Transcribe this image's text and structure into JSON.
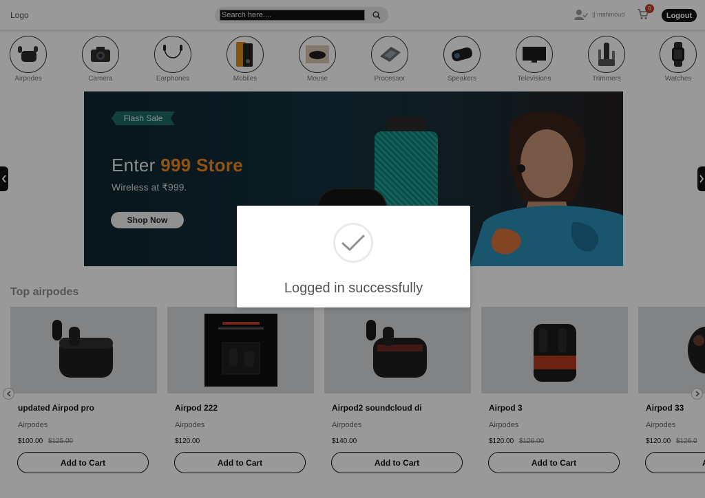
{
  "header": {
    "logo": "Logo",
    "search_placeholder": "Search here....",
    "user_name": "|| mahmoud",
    "cart_count": "0",
    "logout_label": "Logout"
  },
  "categories": [
    {
      "label": "Airpodes",
      "icon": "airpods-icon"
    },
    {
      "label": "Camera",
      "icon": "camera-icon"
    },
    {
      "label": "Earphones",
      "icon": "earphones-icon"
    },
    {
      "label": "Mobiles",
      "icon": "mobile-icon"
    },
    {
      "label": "Mouse",
      "icon": "mouse-icon"
    },
    {
      "label": "Processor",
      "icon": "processor-icon"
    },
    {
      "label": "Speakers",
      "icon": "speaker-icon"
    },
    {
      "label": "Televisions",
      "icon": "television-icon"
    },
    {
      "label": "Trimmers",
      "icon": "trimmer-icon"
    },
    {
      "label": "Watches",
      "icon": "watch-icon"
    }
  ],
  "banner": {
    "badge": "Flash Sale",
    "title_prefix": "Enter",
    "title_highlight": "999 Store",
    "subtitle": "Wireless at ₹999.",
    "cta": "Shop Now"
  },
  "section": {
    "title": "Top airpodes"
  },
  "products": [
    {
      "name": "updated Airpod pro",
      "category": "Airpodes",
      "price": "$100.00",
      "old_price": "$125.00",
      "button": "Add to Cart"
    },
    {
      "name": "Airpod 222",
      "category": "Airpodes",
      "price": "$120.00",
      "old_price": "",
      "button": "Add to Cart"
    },
    {
      "name": "Airpod2 soundcloud di",
      "category": "Airpodes",
      "price": "$140.00",
      "old_price": "",
      "button": "Add to Cart"
    },
    {
      "name": "Airpod 3",
      "category": "Airpodes",
      "price": "$120.00",
      "old_price": "$126.00",
      "button": "Add to Cart"
    },
    {
      "name": "Airpod 33",
      "category": "Airpodes",
      "price": "$120.00",
      "old_price": "$126.0",
      "button": "Ad"
    }
  ],
  "modal": {
    "message": "Logged in successfully"
  },
  "colors": {
    "accent": "#f08a22",
    "flash_badge": "#1d6b66",
    "cart_badge": "#c0392b",
    "modal_check": "#e8ece6"
  }
}
